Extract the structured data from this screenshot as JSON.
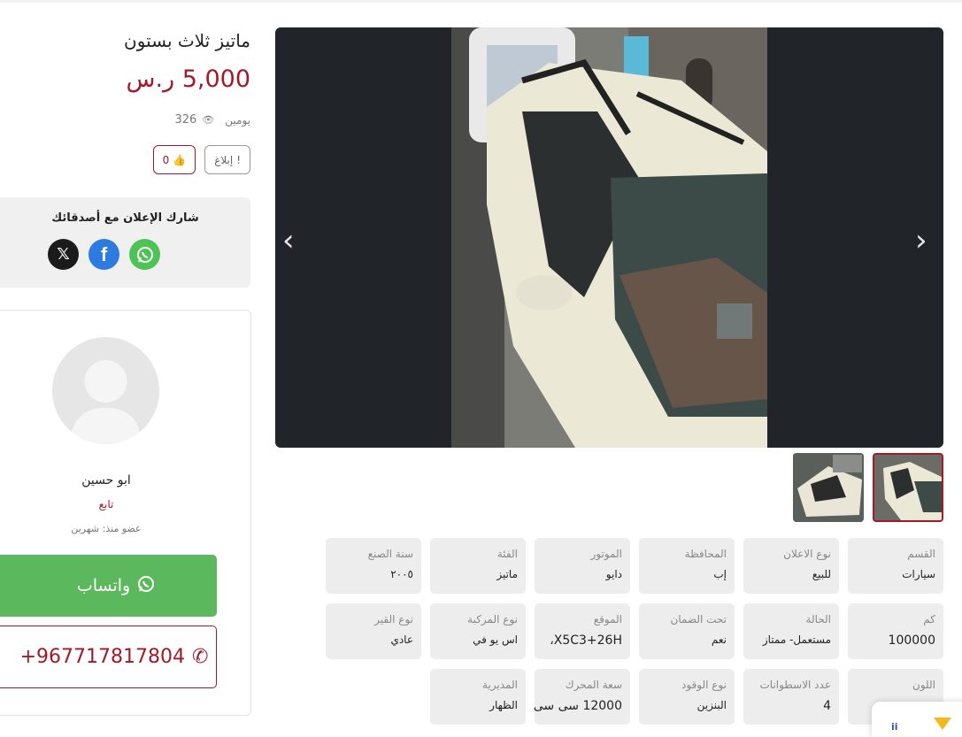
{
  "listing": {
    "title": "ماتيز ثلاث بستون",
    "price": "5,000 ر.س",
    "posted": "يومين",
    "views": "326",
    "report_label": "إبلاغ",
    "likes": "0"
  },
  "share": {
    "title": "شارك الإعلان مع أصدقائك",
    "icons": [
      "x-icon",
      "facebook-icon",
      "whatsapp-icon"
    ]
  },
  "seller": {
    "name": "ابو حسين",
    "role": "تابع",
    "member_since": "عضو منذ: شهرين",
    "whatsapp_label": "واتساب",
    "phone": "+967717817804"
  },
  "gallery": {
    "thumbnail_count": 2,
    "active_thumbnail": 1
  },
  "specs": [
    {
      "label": "القسم",
      "value": "سيارات"
    },
    {
      "label": "نوع الاعلان",
      "value": "للبيع"
    },
    {
      "label": "المحافظة",
      "value": "إب"
    },
    {
      "label": "الموتور",
      "value": "دايو"
    },
    {
      "label": "الفئة",
      "value": "ماتيز"
    },
    {
      "label": "سنة الصنع",
      "value": "٢٠٠٥"
    },
    {
      "label": "كم",
      "value": "100000"
    },
    {
      "label": "الحالة",
      "value": "مستعمل- ممتاز"
    },
    {
      "label": "تحت الضمان",
      "value": "نعم"
    },
    {
      "label": "الموقع",
      "value": "X5C3+26H،"
    },
    {
      "label": "نوع المركبة",
      "value": "اس يو في"
    },
    {
      "label": "نوع القير",
      "value": "عادي"
    },
    {
      "label": "اللون",
      "value": ""
    },
    {
      "label": "عدد الاسطوانات",
      "value": "4"
    },
    {
      "label": "نوع الوقود",
      "value": "البنزين"
    },
    {
      "label": "سعة المحرك",
      "value": "12000 سى سى"
    },
    {
      "label": "المديرية",
      "value": "الظهار"
    }
  ],
  "colors": {
    "brand": "#a11a2a",
    "whatsapp": "#5cb85c",
    "gallery_bg": "#212428"
  }
}
